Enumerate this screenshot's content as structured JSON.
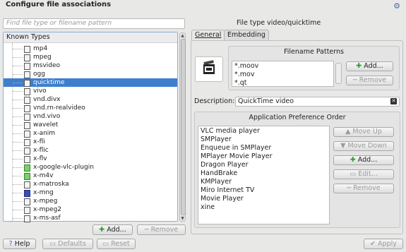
{
  "window": {
    "title": "Configure file associations"
  },
  "search": {
    "placeholder": "Find file type or filename pattern"
  },
  "known_types": {
    "header": "Known Types",
    "items": [
      {
        "label": "mp4",
        "icon": "file-icon"
      },
      {
        "label": "mpeg",
        "icon": "file-icon"
      },
      {
        "label": "msvideo",
        "icon": "file-icon"
      },
      {
        "label": "ogg",
        "icon": "file-icon"
      },
      {
        "label": "quicktime",
        "icon": "file-icon",
        "selected": true
      },
      {
        "label": "vivo",
        "icon": "file-icon"
      },
      {
        "label": "vnd.divx",
        "icon": "file-icon"
      },
      {
        "label": "vnd.rn-realvideo",
        "icon": "file-icon"
      },
      {
        "label": "vnd.vivo",
        "icon": "file-icon"
      },
      {
        "label": "wavelet",
        "icon": "file-icon"
      },
      {
        "label": "x-anim",
        "icon": "file-icon"
      },
      {
        "label": "x-fli",
        "icon": "file-icon"
      },
      {
        "label": "x-flic",
        "icon": "file-icon"
      },
      {
        "label": "x-flv",
        "icon": "file-icon"
      },
      {
        "label": "x-google-vlc-plugin",
        "icon": "green-icon"
      },
      {
        "label": "x-m4v",
        "icon": "green-icon"
      },
      {
        "label": "x-matroska",
        "icon": "file-icon"
      },
      {
        "label": "x-mng",
        "icon": "blue-icon"
      },
      {
        "label": "x-mpeg",
        "icon": "file-icon"
      },
      {
        "label": "x-mpeg2",
        "icon": "file-icon"
      },
      {
        "label": "x-ms-asf",
        "icon": "file-icon"
      }
    ],
    "add_label": "Add...",
    "remove_label": "Remove"
  },
  "detail": {
    "title": "File type video/quicktime",
    "tabs": [
      "General",
      "Embedding"
    ],
    "patterns": {
      "title": "Filename Patterns",
      "items": [
        "*.moov",
        "*.mov",
        "*.qt"
      ],
      "add_label": "Add...",
      "remove_label": "Remove"
    },
    "description": {
      "label": "Description:",
      "value": "QuickTime video"
    },
    "apps": {
      "title": "Application Preference Order",
      "items": [
        "VLC media player",
        "SMPlayer",
        "Enqueue in SMPlayer",
        "MPlayer Movie Player",
        "Dragon Player",
        "HandBrake",
        "KMPlayer",
        "Miro Internet TV",
        "Movie Player",
        "xine"
      ],
      "move_up_label": "Move Up",
      "move_down_label": "Move Down",
      "add_label": "Add...",
      "edit_label": "Edit...",
      "remove_label": "Remove"
    }
  },
  "footer": {
    "help_label": "Help",
    "defaults_label": "Defaults",
    "reset_label": "Reset",
    "apply_label": "Apply"
  }
}
